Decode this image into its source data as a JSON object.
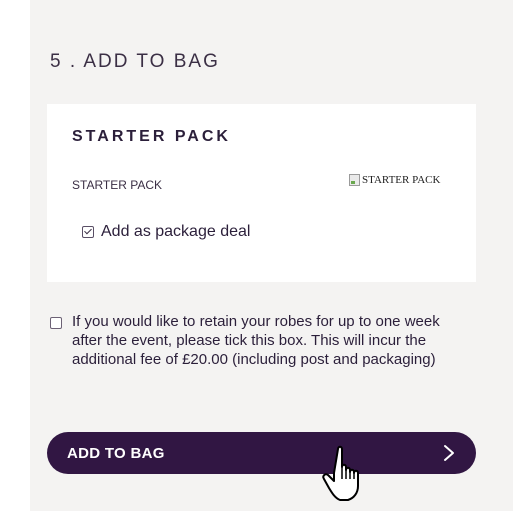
{
  "section": {
    "title": "5 . ADD TO BAG"
  },
  "card": {
    "title": "STARTER PACK",
    "subtitle": "STARTER PACK",
    "image_alt": "STARTER PACK",
    "package_checkbox_label": "Add as package deal",
    "package_checked": true
  },
  "retain": {
    "checked": false,
    "text": "If you would like to retain your robes for up to one week after the event, please tick this box. This will incur the additional fee of £20.00 (including post and packaging)"
  },
  "button": {
    "label": "ADD TO BAG",
    "icon": "chevron-right-icon"
  },
  "cursor": {
    "icon": "hand-pointer-icon"
  },
  "colors": {
    "panel_bg": "#f4f3f2",
    "card_bg": "#ffffff",
    "button_bg": "#311643",
    "text": "#2b1f3a"
  }
}
